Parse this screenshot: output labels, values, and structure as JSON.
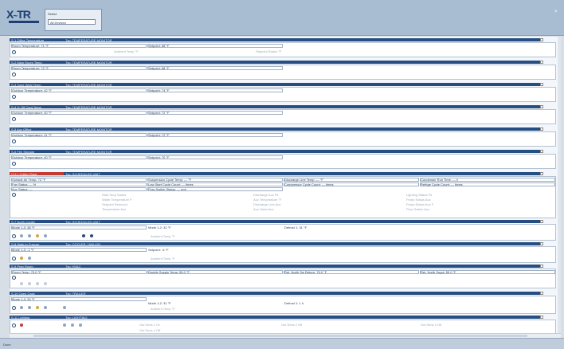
{
  "header": {
    "select_label": "Select",
    "select_value": "All Devices",
    "close_glyph": "×"
  },
  "panels": [
    {
      "title": "S-1 Office Temperature",
      "type": "Typ: TEMPERATURE MONITOR",
      "f1": "Room Temperature:  71 °F",
      "f2": "Setpoint:  68 °F",
      "sub": "Ambient Temp °F",
      "sub2": "Setpoint Status °F"
    },
    {
      "title": "S-2 Main Room Temp",
      "type": "Typ: TEMPERATURE MONITOR",
      "f1": "Room Temperature:  72 °F",
      "f2": "Setpoint:  68 °F",
      "sub": "",
      "sub2": ""
    },
    {
      "title": "S-3 Zone West Temp",
      "type": "Typ: TEMPERATURE MONITOR",
      "f1": "Outdoor Temperature:  42 °F",
      "f2": "Setpoint:  74 °F",
      "sub": "",
      "sub2": ""
    },
    {
      "title": "S-4 Tr Off Card Temp",
      "type": "Typ: TEMPERATURE MONITOR",
      "f1": "Outdoor Temperature:  40 °F",
      "f2": "Setpoint:  72 °F",
      "sub": "",
      "sub2": ""
    },
    {
      "title": "S-5 Aux Office",
      "type": "Typ: TEMPERATURE MONITOR",
      "f1": "Outdoor Temperature:  41 °F",
      "f2": "Setpoint:  72 °F",
      "sub": "",
      "sub2": ""
    },
    {
      "title": "S-6 Fire Storage",
      "type": "Typ: TEMPERATURE MONITOR",
      "f1": "Outdoor Temperature:  40 °F",
      "f2": "Setpoint:  70 °F",
      "sub": "",
      "sub2": ""
    }
  ],
  "chiller": {
    "title": "CH-1 Chiller Plant",
    "type": "Typ: SCHEDULED UNIT",
    "row1": [
      "Outside Air Temp:  72 °F",
      "Suspension Cycle Temp:  --- °F",
      "Discharge Line Temp:  --- °F",
      "Condenser Run Time:  --- h"
    ],
    "row2": [
      "Fan Status:  --- %",
      "Low Start Cycle Count:  --- times",
      "Compressor Cycle Count:  --- times",
      "Refrige Cycle Count:  --- times"
    ],
    "row3": [
      "Aux Status:  ---",
      "Flow Switch Status:  --- nml"
    ],
    "subs": [
      [
        "Start Stop Status",
        "Water Temperature F",
        "Setpoint Reduced",
        "Temperature Aux"
      ],
      [
        "Discharge Aux Flt",
        "Aux Temperature °F",
        "Discharge Line Aux",
        "Aux Valve Aux"
      ],
      [
        "Lighting Status Flt",
        "Pump Status Aux",
        "Pump Status Aux F",
        "Flow Switch Aux"
      ]
    ]
  },
  "units": [
    {
      "title": "S-7 North Cooler",
      "type": "Typ: SCHEDULED UNIT",
      "f1": "Mode 1-3:  38 °F",
      "f2": "Mode 1-2:  32 °F",
      "f3": "Defrost 1:  31 °F",
      "sub": "Ambient Temp °F"
    },
    {
      "title": "S-8 Walk-In Freezer",
      "type": "Typ: COOLER / WALKIN",
      "f1": "Mode 1-3:  -1 °F",
      "f2": "Setpoint:  -5 °F",
      "f3": "",
      "sub": "Ambient Temp °F"
    },
    {
      "title": "S-9 Prep Room",
      "type": "Typ: HVAC",
      "f1": "Room Temp:  75.0 °F",
      "f2": "Double Supply Temp:  55.0 °F",
      "f3": "Ret. North Sw Return:  75.0 °F",
      "f4": "Ret. North Suppl:  55.0 °F"
    },
    {
      "title": "S-10 Open Case",
      "type": "Typ: TRAILER",
      "f1": "Mode 1-3:  33 °F",
      "f2": "Mode 1-2:  31 °F",
      "f3": "Defrost 1:  1 h",
      "sub": "Ambient Temp °F"
    },
    {
      "title": "S-11 Lighting",
      "type": "Typ: LIGHTING",
      "f1": "Out Sens 1 On",
      "f2": "Out Sens 2 Off",
      "f3": "Out Sens 3 Off",
      "sub": "Out Sens 4 Off"
    }
  ],
  "status_text": "Done",
  "colors": {
    "header": "#274e82",
    "alarm": "#c43b33",
    "topbar": "#a9bdd2"
  }
}
